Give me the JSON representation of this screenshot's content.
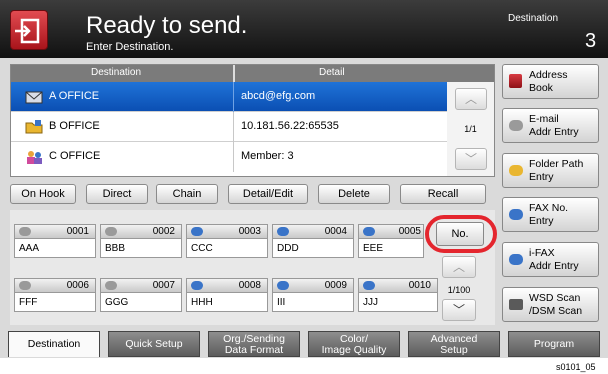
{
  "header": {
    "title": "Ready to send.",
    "subtitle": "Enter Destination.",
    "destination_label": "Destination",
    "destination_count": "3"
  },
  "list": {
    "col_destination": "Destination",
    "col_detail": "Detail",
    "rows": [
      {
        "name": "A OFFICE",
        "detail": "abcd@efg.com",
        "icon": "email-icon",
        "selected": true
      },
      {
        "name": "B OFFICE",
        "detail": "10.181.56.22:65535",
        "icon": "folder-icon",
        "selected": false
      },
      {
        "name": "C OFFICE",
        "detail": "Member:   3",
        "icon": "group-icon",
        "selected": false
      }
    ],
    "page": "1/1"
  },
  "actions": [
    "On Hook",
    "Direct",
    "Chain",
    "Detail/Edit",
    "Delete",
    "Recall"
  ],
  "one_touch": [
    {
      "num": "0001",
      "label": "AAA"
    },
    {
      "num": "0002",
      "label": "BBB"
    },
    {
      "num": "0003",
      "label": "CCC"
    },
    {
      "num": "0004",
      "label": "DDD"
    },
    {
      "num": "0005",
      "label": "EEE"
    },
    {
      "num": "0006",
      "label": "FFF"
    },
    {
      "num": "0007",
      "label": "GGG"
    },
    {
      "num": "0008",
      "label": "HHH"
    },
    {
      "num": "0009",
      "label": "III"
    },
    {
      "num": "0010",
      "label": "JJJ"
    }
  ],
  "one_touch_page": "1/100",
  "no_button": "No.",
  "sidebar": [
    {
      "line1": "Address",
      "line2": "Book"
    },
    {
      "line1": "E-mail",
      "line2": "Addr Entry"
    },
    {
      "line1": "Folder Path",
      "line2": "Entry"
    },
    {
      "line1": "FAX No.",
      "line2": "Entry"
    },
    {
      "line1": "i-FAX",
      "line2": "Addr Entry"
    },
    {
      "line1": "WSD Scan",
      "line2": "/DSM Scan"
    }
  ],
  "tabs": [
    {
      "line1": "Destination",
      "line2": ""
    },
    {
      "line1": "Quick Setup",
      "line2": ""
    },
    {
      "line1": "Org./Sending",
      "line2": "Data Format"
    },
    {
      "line1": "Color/",
      "line2": "Image Quality"
    },
    {
      "line1": "Advanced",
      "line2": "Setup"
    },
    {
      "line1": "Program",
      "line2": ""
    }
  ],
  "figure_code": "s0101_05",
  "colors": {
    "accent_red": "#e4262e",
    "selection_blue": "#1f73d8"
  }
}
